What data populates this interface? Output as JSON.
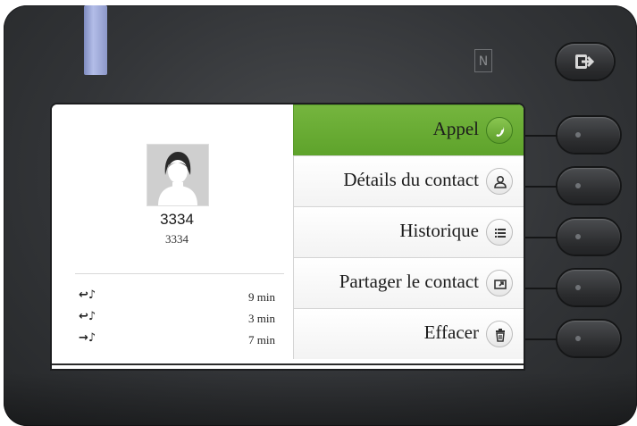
{
  "contact": {
    "name": "3334",
    "number": "3334"
  },
  "history": [
    {
      "direction": "incoming",
      "direction_glyph": "↩♪",
      "duration": "9 min"
    },
    {
      "direction": "incoming",
      "direction_glyph": "↩♪",
      "duration": "3 min"
    },
    {
      "direction": "outgoing",
      "direction_glyph": "→♪",
      "duration": "7 min"
    }
  ],
  "menu": {
    "items": [
      {
        "label": "Appel",
        "icon": "phone-icon",
        "active": true
      },
      {
        "label": "Détails du contact",
        "icon": "person-icon",
        "active": false
      },
      {
        "label": "Historique",
        "icon": "list-icon",
        "active": false
      },
      {
        "label": "Partager le contact",
        "icon": "share-icon",
        "active": false
      },
      {
        "label": "Effacer",
        "icon": "trash-icon",
        "active": false
      }
    ]
  },
  "device": {
    "nfc_glyph": "N",
    "accent_color": "#6aad35",
    "led_color": "#a9b4e3"
  }
}
